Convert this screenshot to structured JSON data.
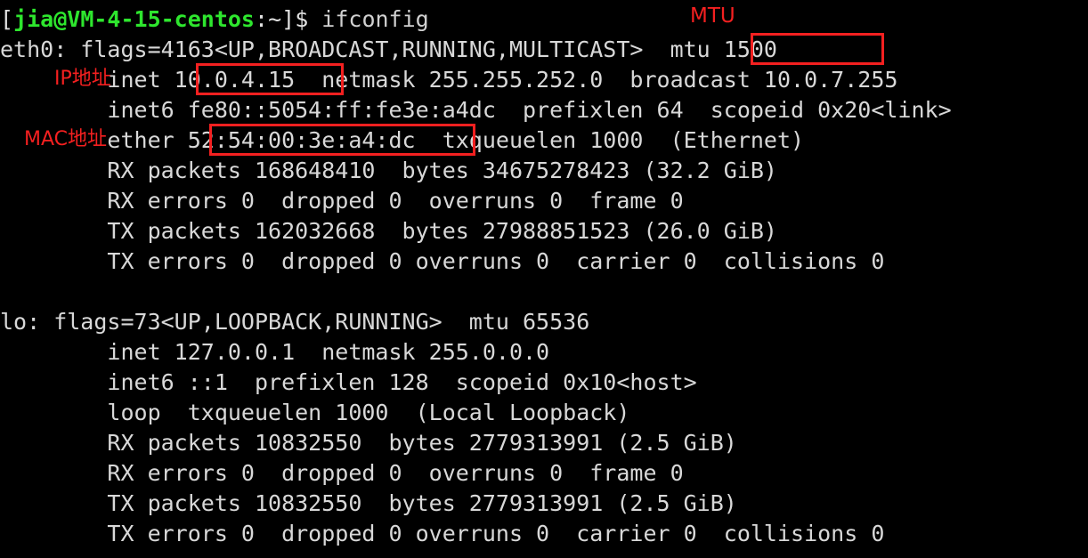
{
  "terminal": {
    "background_color": "#000000",
    "foreground_color": "#d8d8d8",
    "prompt_color": "#2ee62e",
    "annotation_color": "#f42020",
    "prompt": {
      "open_bracket": "[",
      "user_host": "jia@VM-4-15-centos",
      "separator": ":",
      "path": "~",
      "close_bracket": "]",
      "dollar": "$ ",
      "command": "ifconfig"
    },
    "ghost_line": "        ",
    "lines": [
      "eth0: flags=4163<UP,BROADCAST,RUNNING,MULTICAST>  mtu 1500",
      "        inet 10.0.4.15  netmask 255.255.252.0  broadcast 10.0.7.255",
      "        inet6 fe80::5054:ff:fe3e:a4dc  prefixlen 64  scopeid 0x20<link>",
      "        ether 52:54:00:3e:a4:dc  txqueuelen 1000  (Ethernet)",
      "        RX packets 168648410  bytes 34675278423 (32.2 GiB)",
      "        RX errors 0  dropped 0  overruns 0  frame 0",
      "        TX packets 162032668  bytes 27988851523 (26.0 GiB)",
      "        TX errors 0  dropped 0 overruns 0  carrier 0  collisions 0",
      "",
      "lo: flags=73<UP,LOOPBACK,RUNNING>  mtu 65536",
      "        inet 127.0.0.1  netmask 255.0.0.0",
      "        inet6 ::1  prefixlen 128  scopeid 0x10<host>",
      "        loop  txqueuelen 1000  (Local Loopback)",
      "        RX packets 10832550  bytes 2779313991 (2.5 GiB)",
      "        RX errors 0  dropped 0  overruns 0  frame 0",
      "        TX packets 10832550  bytes 2779313991 (2.5 GiB)",
      "        TX errors 0  dropped 0 overruns 0  carrier 0  collisions 0"
    ],
    "annotations": [
      {
        "id": "mtu",
        "label": "MTU",
        "highlighted_value": "mtu 1500"
      },
      {
        "id": "ip",
        "label": "IP地址",
        "highlighted_value": "10.0.4.15"
      },
      {
        "id": "mac",
        "label": "MAC地址",
        "highlighted_value": "52:54:00:3e:a4:dc"
      }
    ]
  }
}
